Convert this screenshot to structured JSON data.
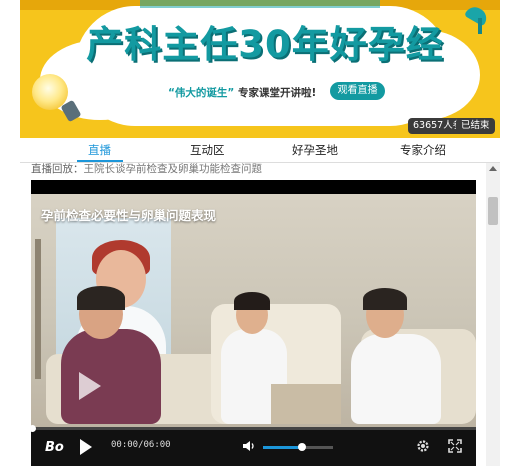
{
  "banner": {
    "title": "产科主任30年好孕经",
    "subline_accent": "“伟大的诞生”",
    "subline_rest": " 专家课堂开讲啦!",
    "live_button": "观看直播",
    "participants": "63657人参与",
    "status": "已结束",
    "colors": {
      "background": "#f6c51c",
      "accent": "#139aa1"
    }
  },
  "tabs": [
    {
      "label": "直播",
      "active": true
    },
    {
      "label": "互动区",
      "active": false
    },
    {
      "label": "好孕圣地",
      "active": false
    },
    {
      "label": "专家介绍",
      "active": false
    }
  ],
  "replay": {
    "prefix": "直播回放：",
    "title": "王院长谈孕前检查及卵巢功能检查问题"
  },
  "video": {
    "overlay_title": "孕前检查必要性与卵巢问题表现",
    "logo": "Bo",
    "time": "00:00/06:00",
    "progress": 0,
    "volume": 0.55
  },
  "icons": {
    "play": "play-icon",
    "volume": "volume-icon",
    "settings": "gear-icon",
    "fullscreen": "fullscreen-icon"
  }
}
